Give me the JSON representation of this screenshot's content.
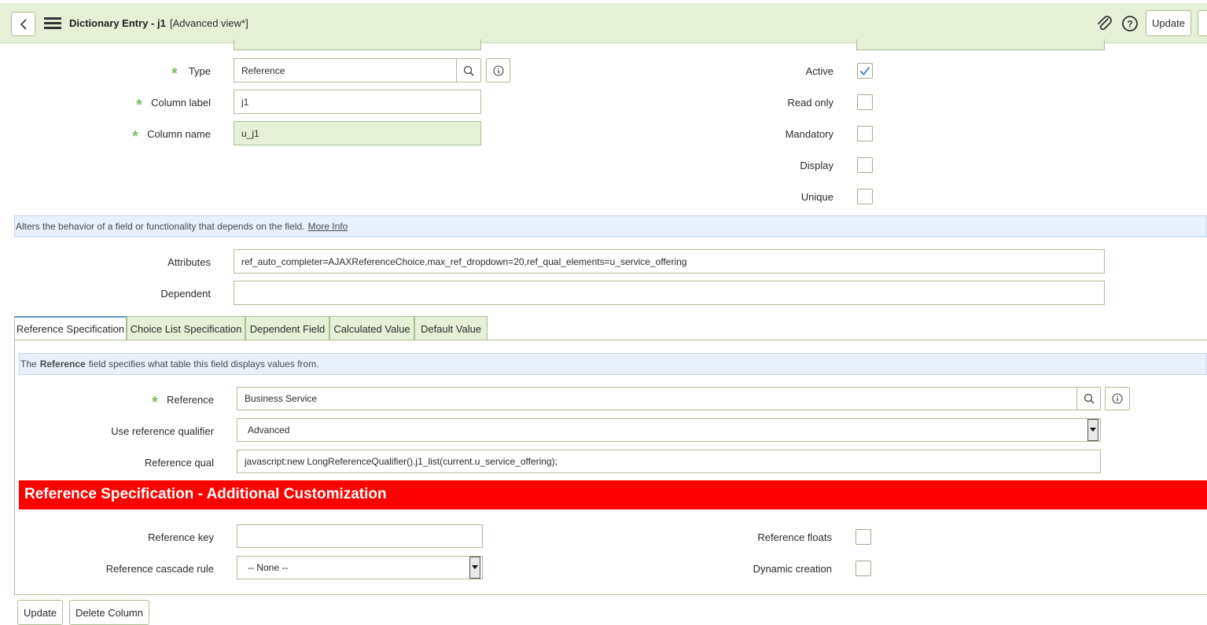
{
  "header": {
    "title": "Dictionary Entry - j1",
    "subtitle": "[Advanced view*]",
    "update_label": "Update"
  },
  "left_fields": {
    "type_label": "Type",
    "type_value": "Reference",
    "column_label_label": "Column label",
    "column_label_value": "j1",
    "column_name_label": "Column name",
    "column_name_value": "u_j1"
  },
  "right_fields": {
    "active_label": "Active",
    "active_checked": true,
    "read_only_label": "Read only",
    "mandatory_label": "Mandatory",
    "display_label": "Display",
    "unique_label": "Unique"
  },
  "info_bar": {
    "text": "Alters the behavior of a field or functionality that depends on the field.",
    "link": "More Info"
  },
  "attributes": {
    "label": "Attributes",
    "value": "ref_auto_completer=AJAXReferenceChoice,max_ref_dropdown=20,ref_qual_elements=u_service_offering",
    "dependent_label": "Dependent",
    "dependent_value": ""
  },
  "tabs": [
    {
      "label": "Reference Specification",
      "active": true
    },
    {
      "label": "Choice List Specification",
      "active": false
    },
    {
      "label": "Dependent Field",
      "active": false
    },
    {
      "label": "Calculated Value",
      "active": false
    },
    {
      "label": "Default Value",
      "active": false
    }
  ],
  "ref_spec": {
    "info_prefix": "The",
    "info_bold": "Reference",
    "info_suffix": "field specifies what table this field displays values from.",
    "reference_label": "Reference",
    "reference_value": "Business Service",
    "qualifier_label": "Use reference qualifier",
    "qualifier_value": "Advanced",
    "ref_qual_label": "Reference qual",
    "ref_qual_value": "javascript:new LongReferenceQualifier().j1_list(current.u_service_offering);",
    "banner": "Reference Specification - Additional Customization",
    "ref_key_label": "Reference key",
    "ref_key_value": "",
    "cascade_label": "Reference cascade rule",
    "cascade_value": "-- None --",
    "floats_label": "Reference floats",
    "dynamic_label": "Dynamic creation"
  },
  "footer": {
    "update_label": "Update",
    "delete_label": "Delete Column"
  },
  "colors": {
    "header_bg": "#e5f0d6",
    "required_star": "#7fbf6a",
    "banner_bg": "#ff0000",
    "info_bg": "#e7f0fb"
  }
}
